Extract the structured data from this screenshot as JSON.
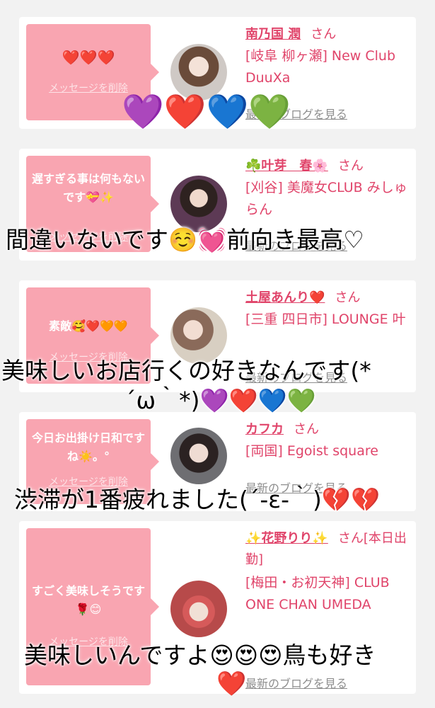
{
  "cards": [
    {
      "message": "❤️❤️❤️",
      "delete_label": "メッセージを削除",
      "name": "南乃国 潤",
      "honorific": "さん",
      "shop": "[岐阜 柳ヶ瀬] New Club DuuXa",
      "blog_label": "最新のブログを見る"
    },
    {
      "message": "遅すぎる事は何もないです💝✨",
      "delete_label": "メッセージを削除",
      "name": "☘️叶芽　春🌸",
      "honorific": "さん",
      "shop": "[刈谷] 美魔女CLUB みしゅらん",
      "blog_label": "最新のブログを見る"
    },
    {
      "message": "素敵🥰❤️🧡🧡",
      "delete_label": "メッセージを削除",
      "name": "土屋あんり❤️",
      "honorific": "さん",
      "shop": "[三重 四日市] LOUNGE 叶",
      "blog_label": "最新のブログを見る"
    },
    {
      "message": "今日お出掛け日和ですね☀️。°",
      "delete_label": "メッセージを削除",
      "name": "カフカ",
      "honorific": "さん",
      "shop": "[両国] Egoist square",
      "blog_label": "最新のブログを見る"
    },
    {
      "message": "すごく美味しそうです🌹😊",
      "delete_label": "メッセージを削除",
      "name": "✨花野りり✨",
      "honorific": "さん[本日出勤]",
      "shop": "[梅田・お初天神] CLUB ONE CHAN UMEDA",
      "blog_label": "最新のブログを見る"
    }
  ],
  "overlays": {
    "hearts_top": "💜❤️💙💚",
    "line1": "間違いないです☺️💓前向き最高♡",
    "line2a": "美味しいお店行くの好きなんです(*",
    "line2b": "´ω｀*)💜❤️💙💚",
    "line3": "渋滞が1番疲れました(´-ε-｀)💔💔",
    "line4": "美味しいんですよ😍😍😍鳥も好き",
    "heart_bottom": "❤️"
  },
  "colors": {
    "accent": "#e0446a",
    "bubble": "#f9a5b1",
    "background": "#f2f2f2"
  }
}
